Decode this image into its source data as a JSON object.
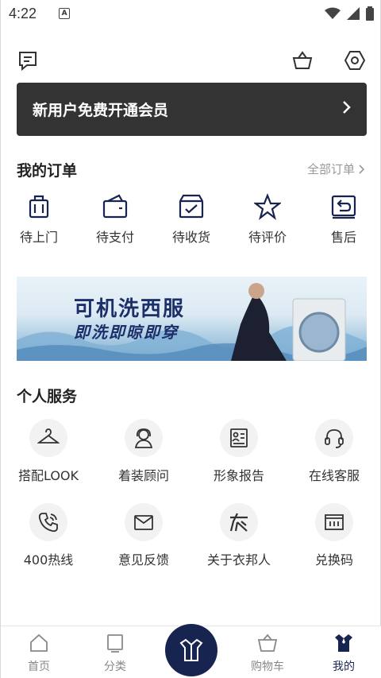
{
  "status_bar": {
    "time": "4:22",
    "notification_icon": "a-icon",
    "icons": [
      "wifi-icon",
      "signal-icon",
      "battery-icon"
    ]
  },
  "topbar": {
    "left_icon": "message-icon",
    "right_icons": [
      "basket-icon",
      "settings-hex-icon"
    ]
  },
  "member_banner": {
    "text": "新用户免费开通会员"
  },
  "orders": {
    "title": "我的订单",
    "all_link": "全部订单",
    "items": [
      {
        "label": "待上门",
        "icon": "suitcase-icon"
      },
      {
        "label": "待支付",
        "icon": "wallet-icon"
      },
      {
        "label": "待收货",
        "icon": "receive-box-icon"
      },
      {
        "label": "待评价",
        "icon": "star-icon"
      },
      {
        "label": "售后",
        "icon": "return-icon"
      }
    ]
  },
  "promo": {
    "line1": "可机洗西服",
    "line2": "即洗即晾即穿"
  },
  "services": {
    "title": "个人服务",
    "items": [
      {
        "label": "搭配LOOK",
        "icon": "hanger-icon"
      },
      {
        "label": "着装顾问",
        "icon": "advisor-icon"
      },
      {
        "label": "形象报告",
        "icon": "report-icon"
      },
      {
        "label": "在线客服",
        "icon": "headset-icon"
      },
      {
        "label": "400热线",
        "icon": "phone-icon"
      },
      {
        "label": "意见反馈",
        "icon": "mail-icon"
      },
      {
        "label": "关于衣邦人",
        "icon": "brand-icon"
      },
      {
        "label": "兑换码",
        "icon": "ticket-icon"
      }
    ]
  },
  "tabbar": {
    "items": [
      {
        "label": "首页",
        "icon": "home-icon"
      },
      {
        "label": "分类",
        "icon": "category-icon"
      },
      {
        "label": "",
        "icon": "suit-center-icon"
      },
      {
        "label": "购物车",
        "icon": "cart-icon"
      },
      {
        "label": "我的",
        "icon": "profile-suit-icon"
      }
    ],
    "active": "我的",
    "accent": "#16244f"
  }
}
